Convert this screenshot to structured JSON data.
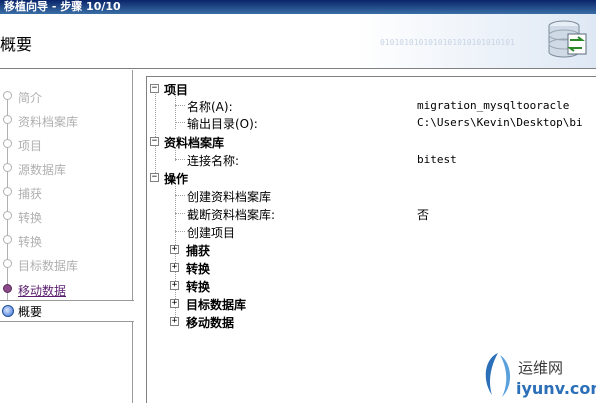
{
  "window": {
    "title": "移植向导 - 步骤 10/10"
  },
  "header": {
    "heading": "概要",
    "binary_text": "0101010101010101010101010101"
  },
  "steps": [
    {
      "label": "简介",
      "state": "disabled"
    },
    {
      "label": "资料档案库",
      "state": "disabled"
    },
    {
      "label": "项目",
      "state": "disabled"
    },
    {
      "label": "源数据库",
      "state": "disabled"
    },
    {
      "label": "捕获",
      "state": "disabled"
    },
    {
      "label": "转换",
      "state": "disabled"
    },
    {
      "label": "转换",
      "state": "disabled"
    },
    {
      "label": "目标数据库",
      "state": "disabled"
    },
    {
      "label": "移动数据",
      "state": "done"
    },
    {
      "label": "概要",
      "state": "current"
    }
  ],
  "tree": {
    "project": {
      "label": "项目",
      "name_label": "名称(A):",
      "name_value": "migration_mysqltooracle",
      "output_label": "输出目录(O):",
      "output_value": "C:\\Users\\Kevin\\Desktop\\bi"
    },
    "repository": {
      "label": "资料档案库",
      "conn_label": "连接名称:",
      "conn_value": "bitest"
    },
    "operations": {
      "label": "操作",
      "create_repo": "创建资料档案库",
      "truncate_repo_label": "截断资料档案库:",
      "truncate_repo_value": "否",
      "create_project": "创建项目",
      "capture": "捕获",
      "convert1": "转换",
      "convert2": "转换",
      "target_db": "目标数据库",
      "move_data": "移动数据"
    }
  },
  "watermark": {
    "text_cn": "运维网",
    "text_url": "iyunv.com"
  },
  "colors": {
    "title_bar": "#0a246a",
    "done_step": "#5a1e6e",
    "watermark_blue": "#2a6fb8"
  }
}
